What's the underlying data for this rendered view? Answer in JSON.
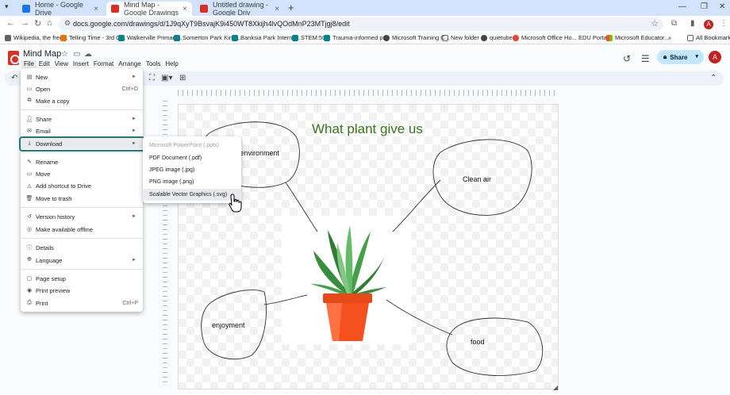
{
  "browser": {
    "tabs": [
      {
        "title": "Home - Google Drive",
        "color": "#1a73e8"
      },
      {
        "title": "Mind Map - Google Drawings",
        "color": "#d93025"
      },
      {
        "title": "Untitled drawing - Google Driv",
        "color": "#d93025"
      }
    ],
    "url": "docs.google.com/drawings/d/1J9qXyT9BsvajK9i450WT8Xkijh4lvQOdMnP23MTjgj8/edit",
    "profile_initial": "A",
    "bookmarks": [
      "Wikipedia, the free...",
      "Telling Time - 3rd G...",
      "Walkerville Primary...",
      "Somerton Park Kind...",
      "Banksia Park Interna...",
      "STEM:500",
      "Trauma-informed pr...",
      "Microsoft Training C...",
      "New folder",
      "quietube",
      "Microsoft Office Ho...",
      "EDU Portal",
      "Microsoft Educator...",
      "All Bookmarks"
    ]
  },
  "app": {
    "doc_title": "Mind Map",
    "menus": [
      "File",
      "Edit",
      "View",
      "Insert",
      "Format",
      "Arrange",
      "Tools",
      "Help"
    ],
    "share_label": "Share",
    "user_initial": "A"
  },
  "file_menu": {
    "new": "New",
    "open": "Open",
    "open_sc": "Ctrl+O",
    "copy": "Make a copy",
    "share": "Share",
    "email": "Email",
    "download": "Download",
    "rename": "Rename",
    "move": "Move",
    "shortcut": "Add shortcut to Drive",
    "trash": "Move to trash",
    "version": "Version history",
    "offline": "Make available offline",
    "details": "Details",
    "language": "Language",
    "pagesetup": "Page setup",
    "preview": "Print preview",
    "print": "Print",
    "print_sc": "Ctrl+P"
  },
  "download_menu": {
    "pptx": "Microsoft PowerPoint (.pptx)",
    "pdf": "PDF Document (.pdf)",
    "jpg": "JPEG image (.jpg)",
    "png": "PNG image (.png)",
    "svg": "Scalable Vector Graphics (.svg)"
  },
  "drawing": {
    "title": "What plant give us",
    "nodes": {
      "environment": "r environment",
      "clean_air": "Clean air",
      "enjoyment": "enjoyment",
      "food": "food"
    }
  },
  "colors": {
    "title_green": "#38761d",
    "highlight_outline": "#1f7a76",
    "share_bg": "#c2e7ff",
    "pot_orange": "#f4511e"
  }
}
